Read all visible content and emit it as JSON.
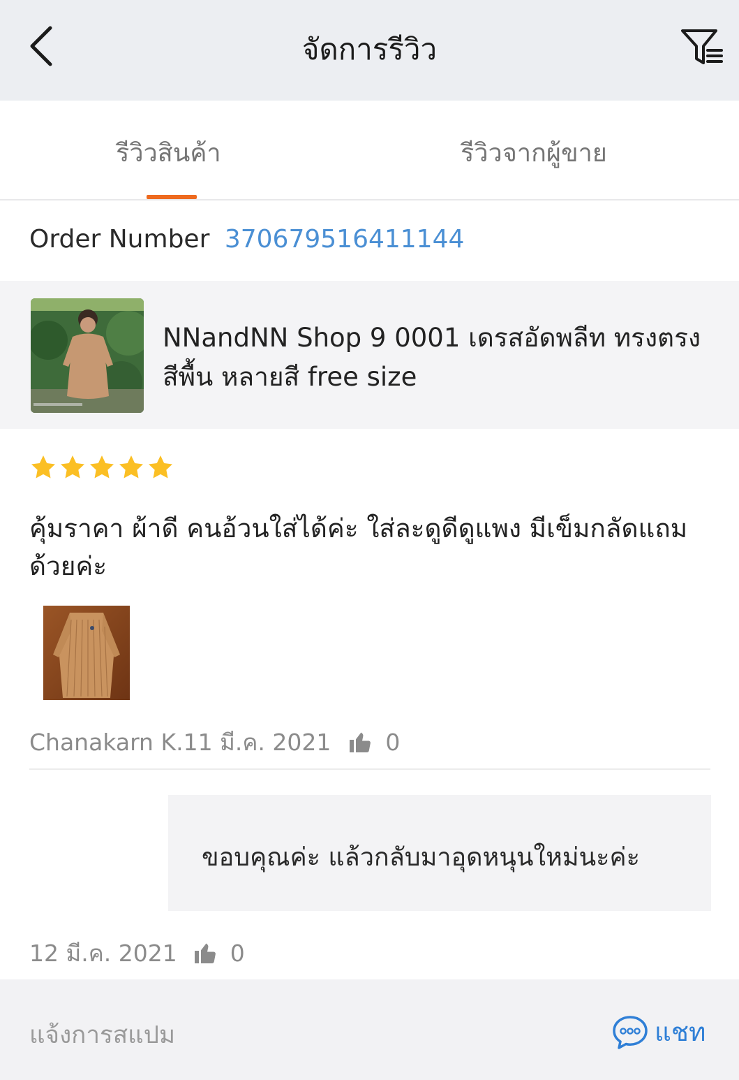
{
  "header": {
    "title": "จัดการรีวิว",
    "back_icon": "chevron-left-icon",
    "filter_icon": "filter-list-icon"
  },
  "tabs": [
    {
      "label": "รีวิวสินค้า",
      "active": true
    },
    {
      "label": "รีวิวจากผู้ขาย",
      "active": false
    }
  ],
  "colors": {
    "accent": "#ee6a1f",
    "link": "#4a8fd4",
    "star": "#fbbf24",
    "chat": "#2f7fd6"
  },
  "order": {
    "label": "Order Number",
    "number": "370679516411144"
  },
  "product": {
    "name": "NNandNN Shop 9 0001 เดรสอัดพลีท ทรงตรง สีพื้น หลายสี free size"
  },
  "review": {
    "rating": 5,
    "max_rating": 5,
    "text": "คุ้มราคา ผ้าดี คนอ้วนใส่ได้ค่ะ ใส่ละดูดีดูแพง มีเข็มกลัดแถมด้วยค่ะ",
    "author_date": "Chanakarn K.11 มี.ค. 2021",
    "likes": "0"
  },
  "seller_reply": {
    "text": "ขอบคุณค่ะ แล้วกลับมาอุดหนุนใหม่นะค่ะ",
    "date": "12 มี.ค. 2021",
    "likes": "0"
  },
  "footer": {
    "report_label": "แจ้งการสแปม",
    "chat_label": "แชท",
    "chat_icon": "chat-bubble-icon"
  }
}
